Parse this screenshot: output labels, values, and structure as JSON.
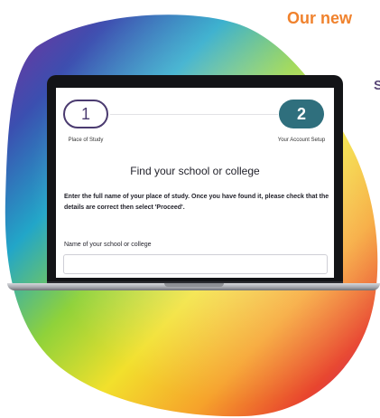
{
  "header": {
    "title": "Our new",
    "side_text": "S"
  },
  "app": {
    "steps": [
      {
        "number": "1",
        "label": "Place of Study",
        "state": "completed"
      },
      {
        "number": "2",
        "label": "Your Account Setup",
        "state": "current"
      }
    ],
    "title": "Find your school or college",
    "instructions": "Enter the full name of your place of study. Once you have found it, please check that the details are correct then select 'Proceed'.",
    "field": {
      "label": "Name of your school or college",
      "value": "",
      "placeholder": ""
    }
  },
  "colors": {
    "accent_orange": "#f0822d",
    "step_outline_purple": "#4b3b70",
    "step_active_teal": "#2f6f7d"
  },
  "icons": [
    "rainbow-blob-graphic",
    "laptop-graphic"
  ]
}
